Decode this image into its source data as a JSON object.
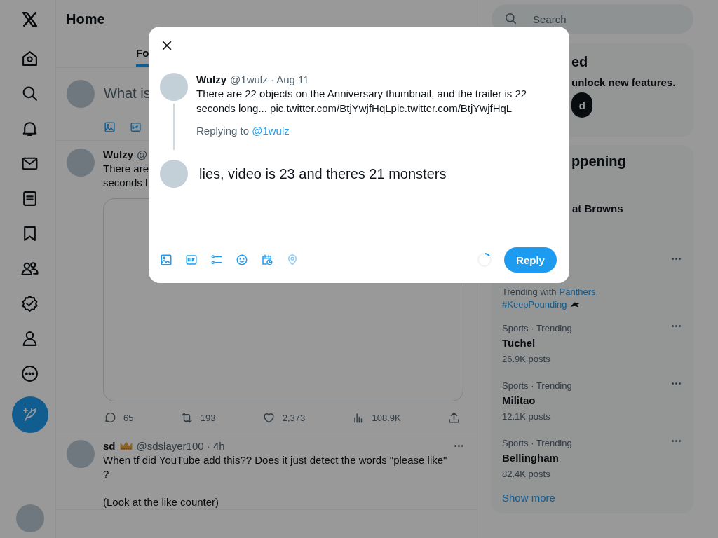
{
  "nav": {
    "items": [
      {
        "kind": "logo"
      },
      {
        "kind": "home"
      },
      {
        "kind": "search"
      },
      {
        "kind": "bell"
      },
      {
        "kind": "mail"
      },
      {
        "kind": "list"
      },
      {
        "kind": "bookmark"
      },
      {
        "kind": "people"
      },
      {
        "kind": "verified"
      },
      {
        "kind": "person"
      },
      {
        "kind": "more"
      }
    ]
  },
  "main": {
    "title": "Home",
    "tabs": [
      {
        "label": "Fo",
        "selected": true
      }
    ],
    "composer": {
      "placeholder": "What is",
      "tools": [
        {
          "kind": "image"
        },
        {
          "kind": "gif"
        }
      ]
    },
    "posts": [
      {
        "kind": "media",
        "name": "Wulzy",
        "handle": "@",
        "lines": [
          "There are",
          "seconds l"
        ],
        "stats": [
          {
            "kind": "reply",
            "count": "65"
          },
          {
            "kind": "repost",
            "count": "193"
          },
          {
            "kind": "like",
            "count": "2,373"
          },
          {
            "kind": "views",
            "count": "108.9K"
          },
          {
            "kind": "share"
          }
        ]
      },
      {
        "kind": "text",
        "name": "sd",
        "badges": [
          {
            "kind": "crown"
          }
        ],
        "handle": "@sdslayer100 · 4h",
        "paragraphs": [
          [
            "When tf did YouTube add this?? Does it just detect the words \"please like\"",
            "?"
          ],
          [
            "(Look at the like counter)"
          ]
        ]
      }
    ]
  },
  "sidebar": {
    "search": {
      "placeholder": "Search"
    },
    "premium": {
      "title": "ed",
      "text": "unlock new features.",
      "button": "d"
    },
    "trends": {
      "title": "ppening",
      "items": [
        {
          "title": "at Browns"
        },
        {
          "context": "Trending with",
          "links": [
            "Panthers,",
            "#KeepPounding"
          ]
        },
        {
          "meta": "Sports · Trending",
          "title": "Tuchel",
          "posts": "26.9K posts"
        },
        {
          "meta": "Sports · Trending",
          "title": "Militao",
          "posts": "12.1K posts"
        },
        {
          "meta": "Sports · Trending",
          "title": "Bellingham",
          "posts": "82.4K posts"
        }
      ],
      "show_more": "Show more"
    }
  },
  "dialog": {
    "tweet": {
      "name": "Wulzy",
      "handle": "@1wulz · Aug 11",
      "text": "There are 22 objects on the Anniversary thumbnail, and the trailer is 22 seconds long... pic.twitter.com/BtjYwjfHqLpic.twitter.com/BtjYwjfHqL"
    },
    "replying_label": "Replying to",
    "replying_to": "@1wulz",
    "reply_text": "lies, video is 23 and theres 21 monsters",
    "tools": [
      {
        "kind": "image",
        "disabled": false
      },
      {
        "kind": "gif",
        "disabled": false
      },
      {
        "kind": "poll",
        "disabled": false
      },
      {
        "kind": "emoji",
        "disabled": false
      },
      {
        "kind": "schedule",
        "disabled": false
      },
      {
        "kind": "location",
        "disabled": true
      }
    ],
    "counter": {
      "level": 0.14
    },
    "button": "Reply"
  }
}
